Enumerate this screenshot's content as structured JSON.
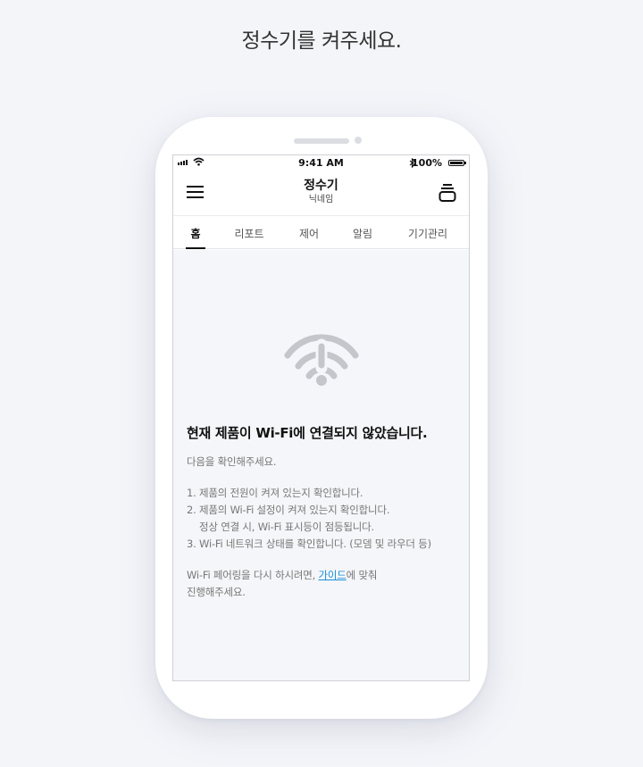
{
  "page": {
    "heading": "정수기를 켜주세요."
  },
  "status_bar": {
    "time": "9:41 AM",
    "battery": "100%"
  },
  "app_bar": {
    "title": "정수기",
    "subtitle": "닉네임"
  },
  "tabs": [
    {
      "label": "홈",
      "active": true
    },
    {
      "label": "리포트",
      "active": false
    },
    {
      "label": "제어",
      "active": false
    },
    {
      "label": "알림",
      "active": false
    },
    {
      "label": "기기관리",
      "active": false
    }
  ],
  "notice": {
    "title": "현재 제품이 Wi-Fi에 연결되지 않았습니다.",
    "intro": "다음을 확인해주세요.",
    "steps": [
      "1. 제품의 전원이 켜져 있는지 확인합니다.",
      "2. 제품의 Wi-Fi 설정이 켜져 있는지 확인합니다.",
      "정상 연결 시, Wi-Fi 표시등이 점등됩니다.",
      "3. Wi-Fi 네트워크 상태를 확인합니다. (모뎀 및 라우더 등)"
    ],
    "pairing_prefix": "Wi-Fi 페어링을 다시 하시려면, ",
    "guide_link": "가이드",
    "pairing_suffix": "에 맞춰",
    "pairing_line2": "진행해주세요."
  },
  "icons": {
    "menu": "hamburger-menu-icon",
    "device": "device-switch-icon",
    "wifi_alert": "wifi-alert-icon"
  },
  "colors": {
    "link": "#1a8fd6",
    "background": "#f4f5f9",
    "icon_gray": "#c4c6cb"
  }
}
